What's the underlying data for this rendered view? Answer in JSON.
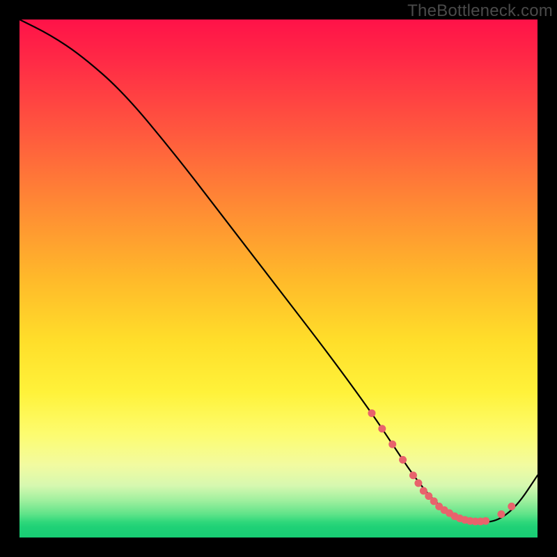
{
  "watermark": "TheBottleneck.com",
  "chart_data": {
    "type": "line",
    "title": "",
    "xlabel": "",
    "ylabel": "",
    "xlim": [
      0,
      100
    ],
    "ylim": [
      0,
      100
    ],
    "series": [
      {
        "name": "curve",
        "x": [
          0,
          6,
          12,
          20,
          30,
          40,
          50,
          60,
          68,
          72,
          76,
          80,
          84,
          88,
          92,
          96,
          100
        ],
        "y": [
          100,
          97,
          93,
          86,
          74,
          61,
          48,
          35,
          24,
          18,
          12,
          7,
          4,
          3,
          3,
          6,
          12
        ]
      }
    ],
    "markers": {
      "name": "highlight-dots",
      "color": "#e8636c",
      "x": [
        68,
        70,
        72,
        74,
        76,
        77,
        78,
        79,
        80,
        81,
        82,
        83,
        84,
        85,
        86,
        87,
        88,
        89,
        90,
        93,
        95
      ],
      "y": [
        24,
        21,
        18,
        15,
        12,
        10.5,
        9,
        8,
        7,
        6,
        5.3,
        4.7,
        4.1,
        3.7,
        3.4,
        3.2,
        3.1,
        3.1,
        3.2,
        4.5,
        6
      ]
    }
  }
}
